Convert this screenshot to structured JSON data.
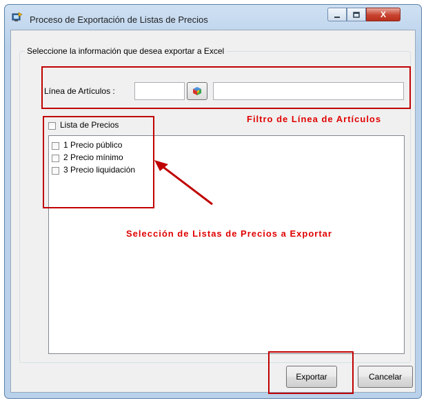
{
  "window": {
    "title": "Proceso de Exportación de Listas de Precios",
    "close_glyph": "X",
    "min_icon": "minimize-icon",
    "max_icon": "maximize-icon",
    "app_icon": "export-app-icon"
  },
  "group": {
    "legend": "Seleccione la información que desea exportar a Excel"
  },
  "linea": {
    "label": "Línea de Artículos :",
    "code_value": "",
    "description_value": "",
    "lookup_icon": "cube-lookup-icon"
  },
  "lista_precios": {
    "header_label": "Lista de Precios",
    "header_checked": false,
    "items": [
      {
        "label": "1 Precio público",
        "checked": false
      },
      {
        "label": "2 Precio mínimo",
        "checked": false
      },
      {
        "label": "3 Precio liquidación",
        "checked": false
      }
    ]
  },
  "annotations": {
    "filtro": "Filtro de Línea de Artículos",
    "seleccion": "Selección de Listas de Precios a Exportar",
    "color": "#e00000"
  },
  "buttons": {
    "exportar": "Exportar",
    "cancelar": "Cancelar"
  }
}
